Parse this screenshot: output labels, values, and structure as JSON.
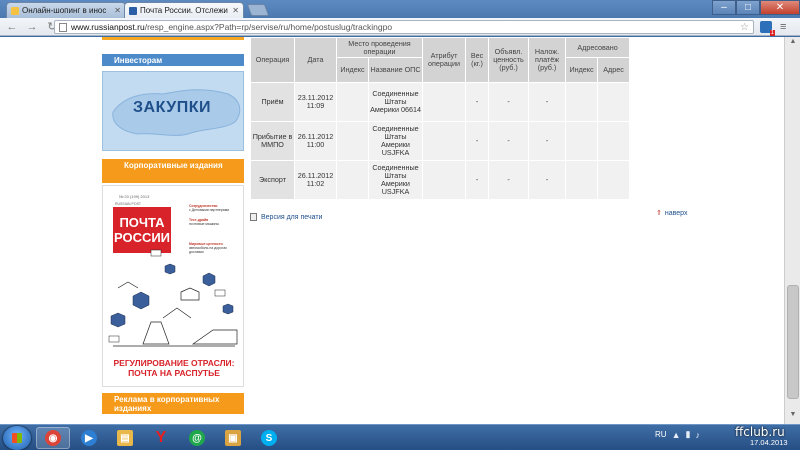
{
  "browser": {
    "tabs": [
      {
        "title": "Онлайн-шопинг в инос",
        "active": false,
        "favicon_color": "#f5c242"
      },
      {
        "title": "Почта России. Отслежи",
        "active": true,
        "favicon_color": "#2a5fa8"
      }
    ],
    "url_host": "www.russianpost.ru",
    "url_path": "/resp_engine.aspx?Path=rp/servise/ru/home/postuslug/trackingpo",
    "window_controls": {
      "minimize": "–",
      "maximize": "□",
      "close": "✕"
    }
  },
  "sidebar": {
    "investors_label": "Инвесторам",
    "zakupki_label": "ЗАКУПКИ",
    "corp_publications_label": "Корпоративные издания",
    "magazine": {
      "issue": "№ 20 (199) 2013",
      "brand": "RUSSIAN POST",
      "logo_line1": "ПОЧТА",
      "logo_line2": "РОССИИ",
      "col1_title": "Сотрудничество",
      "col1_text": "с Деловыми партнерами",
      "col2_title": "Тест-драйв",
      "col2_text": "почтовые машины",
      "col3_title": "Мировые ценности",
      "col3_text": "автомобиль на дорогах доставки",
      "caption": "РЕГУЛИРОВАНИЕ ОТРАСЛИ: ПОЧТА НА РАСПУТЬЕ"
    },
    "ads_label": "Реклама в корпоративных изданиях"
  },
  "tracking": {
    "headers": {
      "operation": "Операция",
      "date": "Дата",
      "place": "Место проведения операции",
      "index": "Индекс",
      "ops_name": "Название ОПС",
      "attribute": "Атрибут операции",
      "weight": "Вес (кг.)",
      "declared_value": "Объявл. ценность (руб.)",
      "cod": "Налож. платёж (руб.)",
      "addressed": "Адресовано",
      "addr_index": "Индекс",
      "address": "Адрес"
    },
    "rows": [
      {
        "operation": "Приём",
        "date": "23.11.2012 11:09",
        "index": "",
        "ops_name": "Соединенные Штаты Америки 06614",
        "attribute": "",
        "weight": "-",
        "declared_value": "-",
        "cod": "-",
        "addr_index": "",
        "address": ""
      },
      {
        "operation": "Прибытие в ММПО",
        "date": "26.11.2012 11:00",
        "index": "",
        "ops_name": "Соединенные Штаты Америки USJFKA",
        "attribute": "",
        "weight": "-",
        "declared_value": "-",
        "cod": "-",
        "addr_index": "",
        "address": ""
      },
      {
        "operation": "Экспорт",
        "date": "26.11.2012 11:02",
        "index": "",
        "ops_name": "Соединенные Штаты Америки USJFKA",
        "attribute": "",
        "weight": "-",
        "declared_value": "-",
        "cod": "-",
        "addr_index": "",
        "address": ""
      }
    ]
  },
  "links": {
    "print_version": "Версия для печати",
    "up": "наверх"
  },
  "taskbar": {
    "apps": [
      {
        "name": "chrome",
        "color": "#db4437",
        "glyph": "◉",
        "active": true
      },
      {
        "name": "media-player",
        "color": "#2d7fd3",
        "glyph": "▶",
        "active": false
      },
      {
        "name": "explorer",
        "color": "#e8b84a",
        "glyph": "▤",
        "active": false
      },
      {
        "name": "yandex",
        "color": "#e61e1e",
        "glyph": "Y",
        "active": false
      },
      {
        "name": "mail-agent",
        "color": "#1fa84b",
        "glyph": "@",
        "active": false
      },
      {
        "name": "photo-viewer",
        "color": "#d9a441",
        "glyph": "▣",
        "active": false
      },
      {
        "name": "skype",
        "color": "#00aff0",
        "glyph": "S",
        "active": false
      }
    ],
    "lang": "RU",
    "date": "17.04.2013"
  },
  "watermark": "ffclub.ru"
}
